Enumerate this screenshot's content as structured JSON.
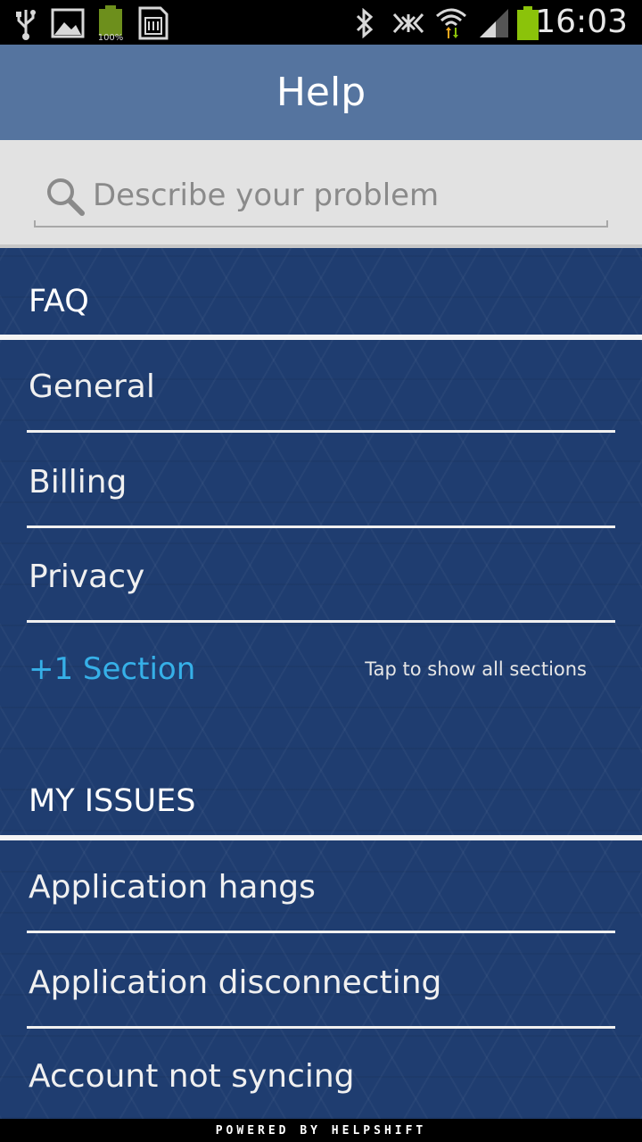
{
  "status_bar": {
    "time": "16:03",
    "battery_small_label": "100%",
    "icons": [
      "usb-icon",
      "image-icon",
      "battery-full-icon",
      "sd-card-icon",
      "bluetooth-icon",
      "nfc-icon",
      "wifi-icon",
      "signal-icon",
      "battery-icon"
    ],
    "battery_color": "#8bc30a"
  },
  "action_bar": {
    "title": "Help",
    "color": "#55749f"
  },
  "search": {
    "placeholder": "Describe your problem"
  },
  "faq": {
    "header": "FAQ",
    "items": [
      "General",
      "Billing",
      "Privacy"
    ],
    "more_label": "+1 Section",
    "more_hint": "Tap to show all sections",
    "more_color": "#36b0e8"
  },
  "issues": {
    "header": "MY ISSUES",
    "items": [
      "Application hangs",
      "Application disconnecting",
      "Account not syncing"
    ]
  },
  "footer": {
    "label": "POWERED BY HELPSHIFT"
  }
}
